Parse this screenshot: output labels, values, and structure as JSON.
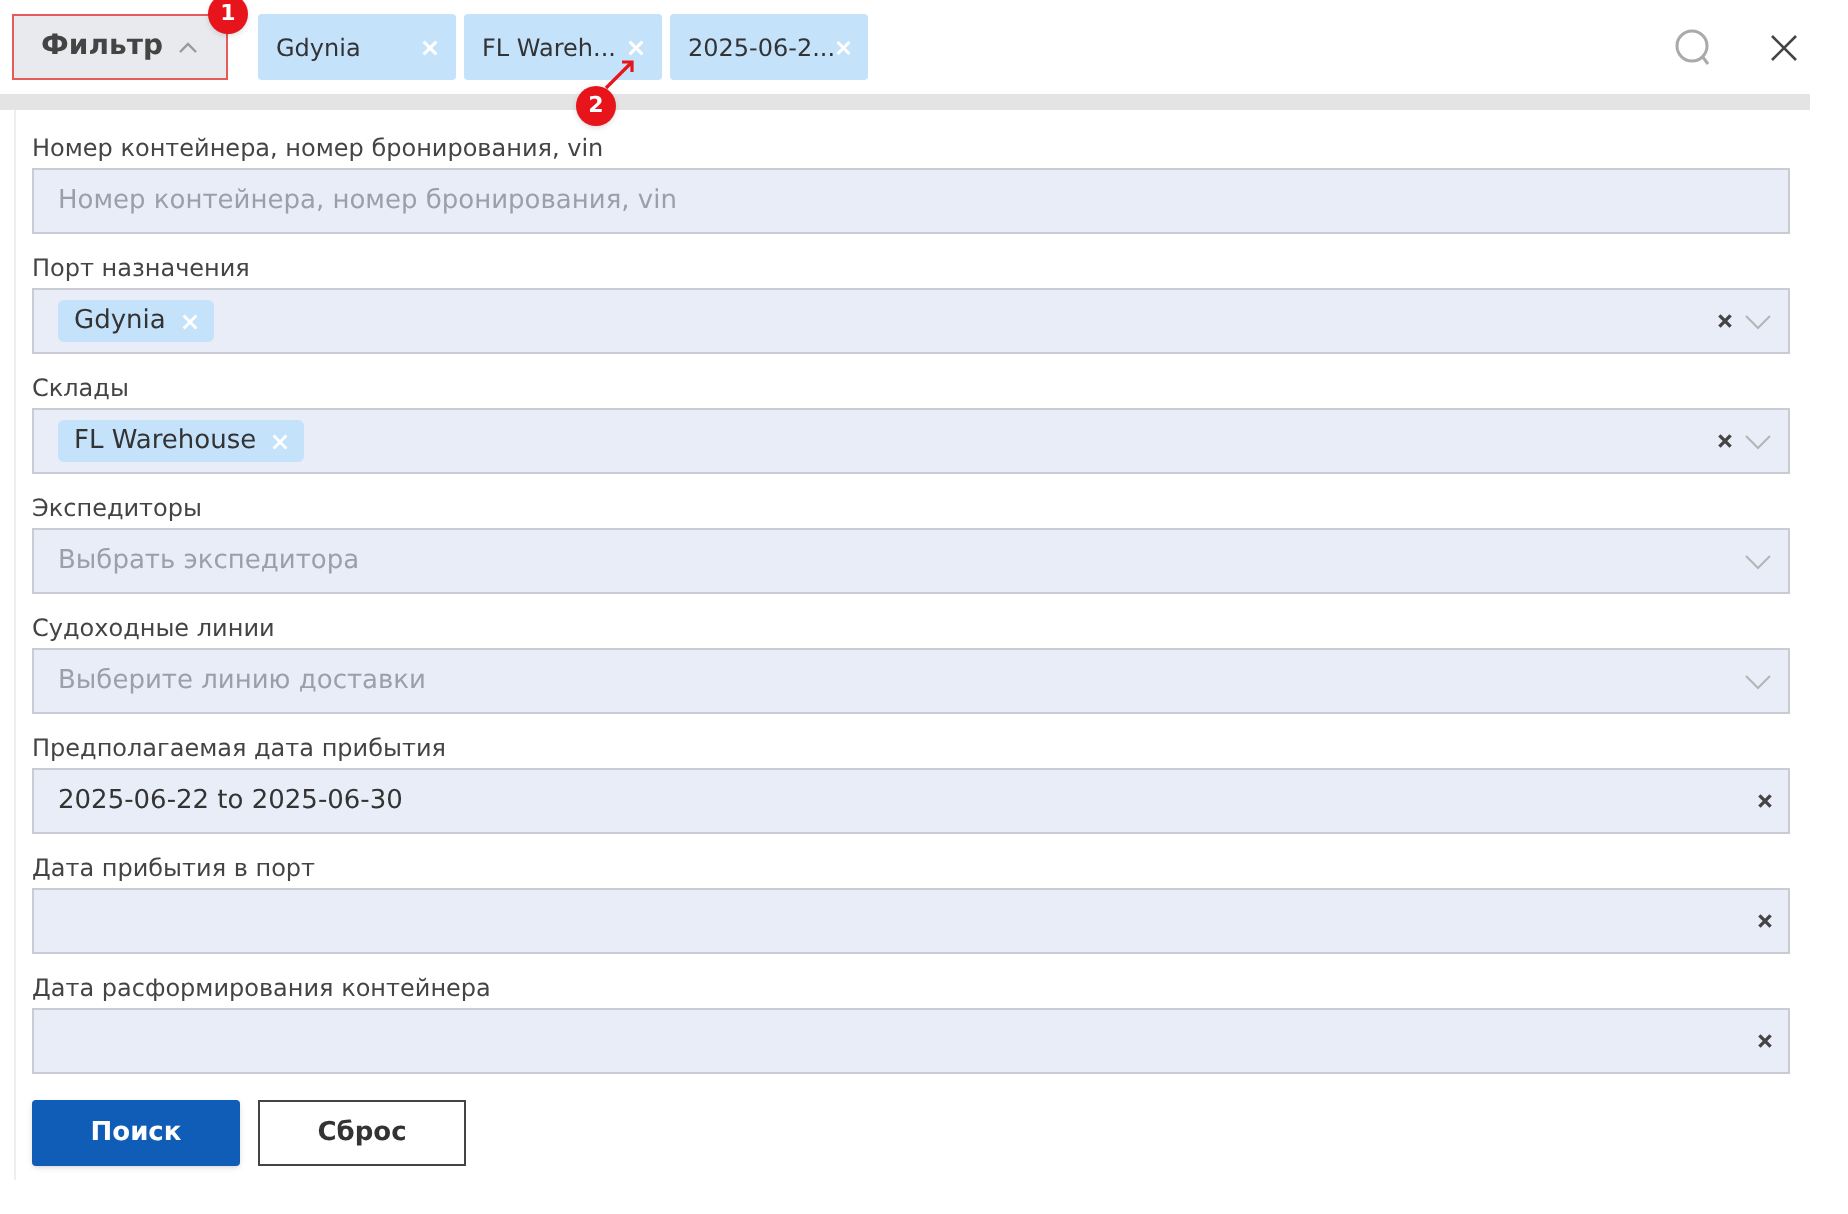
{
  "toolbar": {
    "filter_button": {
      "label": "Фильтр",
      "expanded": true,
      "highlighted": true
    },
    "chips": [
      {
        "label": "Gdynia"
      },
      {
        "label": "FL Wareh..."
      },
      {
        "label": "2025-06-2..."
      }
    ]
  },
  "annotations": [
    {
      "label": "1"
    },
    {
      "label": "2"
    }
  ],
  "form": {
    "fields": [
      {
        "kind": "text",
        "label": "Номер контейнера, номер бронирования, vin",
        "placeholder": "Номер контейнера, номер бронирования, vin"
      },
      {
        "kind": "multiselect",
        "label": "Порт назначения",
        "tags": [
          "Gdynia"
        ],
        "clearable": true
      },
      {
        "kind": "multiselect",
        "label": "Склады",
        "tags": [
          "FL Warehouse"
        ],
        "clearable": true
      },
      {
        "kind": "select",
        "label": "Экспедиторы",
        "placeholder": "Выбрать экспедитора",
        "clearable": false
      },
      {
        "kind": "select",
        "label": "Судоходные линии",
        "placeholder": "Выберите линию доставки",
        "clearable": false
      },
      {
        "kind": "date",
        "label": "Предполагаемая дата прибытия",
        "value": "2025-06-22 to 2025-06-30",
        "clearable": true
      },
      {
        "kind": "date",
        "label": "Дата прибытия в порт",
        "clearable": true
      },
      {
        "kind": "date",
        "label": "Дата расформирования контейнера",
        "clearable": true
      }
    ]
  },
  "buttons": [
    {
      "kind": "primary",
      "label": "Поиск"
    },
    {
      "kind": "secondary",
      "label": "Сброс"
    }
  ]
}
